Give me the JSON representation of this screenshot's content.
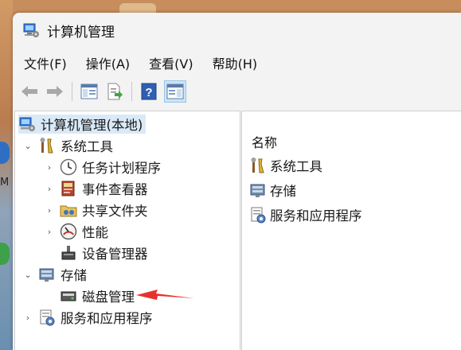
{
  "window": {
    "title": "计算机管理"
  },
  "menu": {
    "items": [
      "文件(F)",
      "操作(A)",
      "查看(V)",
      "帮助(H)"
    ]
  },
  "toolbar": {
    "icons": [
      "back-arrow-icon",
      "forward-arrow-icon",
      "show-hide-console-tree-icon",
      "export-list-icon",
      "help-icon",
      "show-action-pane-icon"
    ]
  },
  "tree": {
    "root": "计算机管理(本地)",
    "system_tools": "系统工具",
    "task_scheduler": "任务计划程序",
    "event_viewer": "事件查看器",
    "shared_folders": "共享文件夹",
    "performance": "性能",
    "device_manager": "设备管理器",
    "storage": "存储",
    "disk_management": "磁盘管理",
    "services_apps": "服务和应用程序"
  },
  "list": {
    "column_name": "名称",
    "items": [
      "系统工具",
      "存储",
      "服务和应用程序"
    ]
  },
  "colors": {
    "annotation_arrow": "#e8312d",
    "selection": "#d9e9f7"
  },
  "desktop": {
    "letter": "M"
  }
}
